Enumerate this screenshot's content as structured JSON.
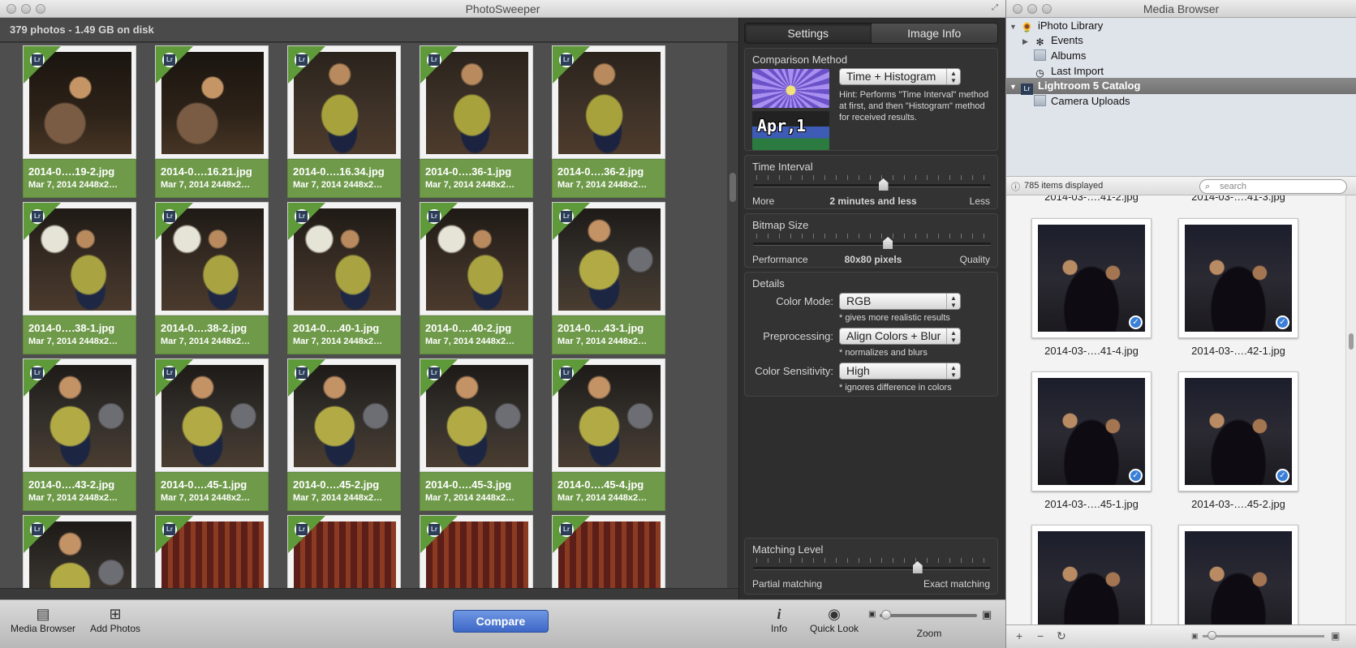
{
  "app": {
    "title": "PhotoSweeper",
    "summary": "379 photos - 1.49 GB on disk"
  },
  "photos": [
    {
      "file": "2014-0….19-2.jpg",
      "meta": "Mar 7, 2014  2448x2…",
      "badge": "Lr",
      "style": "img1"
    },
    {
      "file": "2014-0….16.21.jpg",
      "meta": "Mar 7, 2014  2448x2…",
      "badge": "Lr",
      "style": "img1"
    },
    {
      "file": "2014-0….16.34.jpg",
      "meta": "Mar 7, 2014  2448x2…",
      "badge": "Lr",
      "style": "img2"
    },
    {
      "file": "2014-0….36-1.jpg",
      "meta": "Mar 7, 2014  2448x2…",
      "badge": "Lr",
      "style": "img2"
    },
    {
      "file": "2014-0….36-2.jpg",
      "meta": "Mar 7, 2014  2448x2…",
      "badge": "Lr",
      "style": "img2"
    },
    {
      "file": "2014-0….38-1.jpg",
      "meta": "Mar 7, 2014  2448x2…",
      "badge": "Lr",
      "style": "img3"
    },
    {
      "file": "2014-0….38-2.jpg",
      "meta": "Mar 7, 2014  2448x2…",
      "badge": "Lr",
      "style": "img3"
    },
    {
      "file": "2014-0….40-1.jpg",
      "meta": "Mar 7, 2014  2448x2…",
      "badge": "Lr",
      "style": "img3"
    },
    {
      "file": "2014-0….40-2.jpg",
      "meta": "Mar 7, 2014  2448x2…",
      "badge": "Lr",
      "style": "img3"
    },
    {
      "file": "2014-0….43-1.jpg",
      "meta": "Mar 7, 2014  2448x2…",
      "badge": "Lr",
      "style": "img4"
    },
    {
      "file": "2014-0….43-2.jpg",
      "meta": "Mar 7, 2014  2448x2…",
      "badge": "Lr",
      "style": "img4"
    },
    {
      "file": "2014-0….45-1.jpg",
      "meta": "Mar 7, 2014  2448x2…",
      "badge": "Lr",
      "style": "img4"
    },
    {
      "file": "2014-0….45-2.jpg",
      "meta": "Mar 7, 2014  2448x2…",
      "badge": "Lr",
      "style": "img4"
    },
    {
      "file": "2014-0….45-3.jpg",
      "meta": "Mar 7, 2014  2448x2…",
      "badge": "Lr",
      "style": "img4"
    },
    {
      "file": "2014-0….45-4.jpg",
      "meta": "Mar 7, 2014  2448x2…",
      "badge": "Lr",
      "style": "img4"
    },
    {
      "file": "",
      "meta": "",
      "badge": "Lr",
      "style": "img4"
    },
    {
      "file": "",
      "meta": "",
      "badge": "Lr",
      "style": "img5"
    },
    {
      "file": "",
      "meta": "",
      "badge": "Lr",
      "style": "img5"
    },
    {
      "file": "",
      "meta": "",
      "badge": "Lr",
      "style": "img5"
    },
    {
      "file": "",
      "meta": "",
      "badge": "Lr",
      "style": "img5"
    }
  ],
  "settings": {
    "tabs": [
      {
        "label": "Settings",
        "active": true
      },
      {
        "label": "Image Info",
        "active": false
      }
    ],
    "comparison": {
      "header": "Comparison Method",
      "selected": "Time + Histogram",
      "hint": "Hint: Performs \"Time Interval\" method at first, and then \"Histogram\" method for received results.",
      "preview_text": "Apr,1"
    },
    "time_interval": {
      "header": "Time Interval",
      "min_label": "More",
      "value_label": "2 minutes and less",
      "max_label": "Less",
      "position": 0.55
    },
    "bitmap_size": {
      "header": "Bitmap Size",
      "min_label": "Performance",
      "value_label": "80x80 pixels",
      "max_label": "Quality",
      "position": 0.57
    },
    "details": {
      "header": "Details",
      "color_mode_label": "Color Mode:",
      "color_mode_value": "RGB",
      "color_mode_note": "* gives more realistic results",
      "preprocessing_label": "Preprocessing:",
      "preprocessing_value": "Align Colors + Blur",
      "preprocessing_note": "* normalizes and blurs",
      "sensitivity_label": "Color Sensitivity:",
      "sensitivity_value": "High",
      "sensitivity_note": "* ignores difference in colors"
    },
    "matching_level": {
      "header": "Matching Level",
      "min_label": "Partial matching",
      "max_label": "Exact matching",
      "position": 0.7
    }
  },
  "toolbar": {
    "media_browser": "Media Browser",
    "add_photos": "Add Photos",
    "compare": "Compare",
    "info": "Info",
    "quick_look": "Quick Look",
    "zoom": "Zoom"
  },
  "media_browser": {
    "title": "Media Browser",
    "sources": [
      {
        "label": "iPhoto Library",
        "indent": 0,
        "disclosure": "▼",
        "icon": "iphoto-icon",
        "selected": false
      },
      {
        "label": "Events",
        "indent": 1,
        "disclosure": "▶",
        "icon": "events-icon",
        "selected": false
      },
      {
        "label": "Albums",
        "indent": 1,
        "disclosure": "",
        "icon": "folder-icon",
        "selected": false
      },
      {
        "label": "Last Import",
        "indent": 1,
        "disclosure": "",
        "icon": "clock-icon",
        "selected": false
      },
      {
        "label": "Lightroom 5 Catalog",
        "indent": 0,
        "disclosure": "▼",
        "icon": "lightroom-icon",
        "selected": true
      },
      {
        "label": "Camera Uploads",
        "indent": 1,
        "disclosure": "",
        "icon": "folder-icon",
        "selected": false
      }
    ],
    "count": "785 items displayed",
    "search_placeholder": "search",
    "top_captions": [
      "2014-03-….41-2.jpg",
      "2014-03-….41-3.jpg"
    ],
    "items": [
      {
        "caption": "2014-03-….41-4.jpg",
        "checked": true
      },
      {
        "caption": "2014-03-….42-1.jpg",
        "checked": true
      },
      {
        "caption": "2014-03-….45-1.jpg",
        "checked": true
      },
      {
        "caption": "2014-03-….45-2.jpg",
        "checked": true
      },
      {
        "caption": "",
        "checked": false
      },
      {
        "caption": "",
        "checked": false
      }
    ]
  }
}
